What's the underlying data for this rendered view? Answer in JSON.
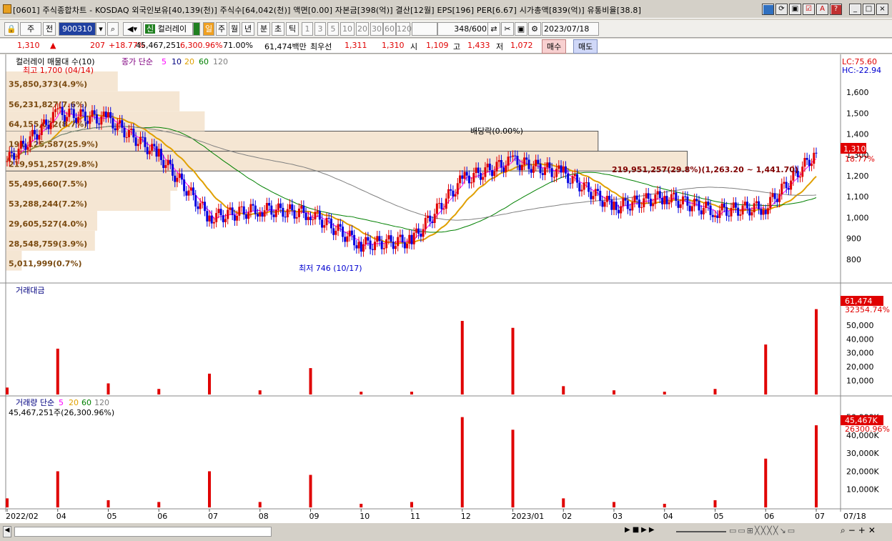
{
  "window": {
    "title": "[0601] 주식종합차트 - KOSDAQ 외국인보유[40,139(천)] 주식수[64,042(천)] 액면[0.00] 자본금[398(억)] 결산[12월] EPS[196] PER[6.67] 시가총액[839(억)] 유통비율[38.8]"
  },
  "toolbar": {
    "type": "주",
    "prev": "전",
    "code": "900310",
    "chart_style": "컬러레이",
    "period_buttons": [
      "일",
      "주",
      "월",
      "년",
      "분",
      "초",
      "틱"
    ],
    "minute_buttons": [
      "1",
      "3",
      "5",
      "10",
      "20",
      "30",
      "60",
      "120"
    ],
    "count": "348",
    "count_total": "/600",
    "date": "2023/07/18"
  },
  "quote": {
    "price": "1,310",
    "change": "207",
    "change_pct": "+18.77%",
    "volume": "45,467,251",
    "vol_ratio": "6,300.96%",
    "pct2": "71.00%",
    "amount": "61,474백만",
    "label_best": "최우선",
    "ask": "1,311",
    "bid": "1,310",
    "open_label": "시",
    "open": "1,109",
    "high_label": "고",
    "high": "1,433",
    "low_label": "저",
    "low": "1,072",
    "buy": "매수",
    "sell": "매도"
  },
  "price_panel": {
    "legend_title": "컬러레이 매물대 수(10)",
    "ma_title": "종가 단순",
    "ma_periods": [
      "5",
      "10",
      "20",
      "60",
      "120"
    ],
    "lc": "LC:75.60",
    "hc": "HC:-22.94",
    "high_marker": "최고 1,700 (04/14)",
    "low_marker": "최저 746 (10/17)",
    "dividend": "배당락(0.00%)",
    "y_ticks": [
      "1,600",
      "1,500",
      "1,400",
      "1,300",
      "1,200",
      "1,100",
      "1,000",
      "900",
      "800"
    ],
    "price_tag": "1,310",
    "price_tag_pct": "18.77%",
    "range_note": "219,951,257(29.8%)(1,263.20 ~ 1,441.70)"
  },
  "volume_profile": [
    {
      "label": "5,011,999(0.7%)",
      "from": 746,
      "to": 841,
      "pct": 0.7
    },
    {
      "label": "28,548,759(3.9%)",
      "from": 841,
      "to": 937,
      "pct": 3.9
    },
    {
      "label": "29,605,527(4.0%)",
      "from": 937,
      "to": 1032,
      "pct": 4.0
    },
    {
      "label": "53,288,244(7.2%)",
      "from": 1032,
      "to": 1128,
      "pct": 7.2
    },
    {
      "label": "55,495,660(7.5%)",
      "from": 1128,
      "to": 1223,
      "pct": 7.5
    },
    {
      "label": "219,951,257(29.8%)",
      "from": 1223,
      "to": 1318,
      "pct": 29.8
    },
    {
      "label": "191,125,587(25.9%)",
      "from": 1318,
      "to": 1414,
      "pct": 25.9
    },
    {
      "label": "64,155,022(8.7%)",
      "from": 1414,
      "to": 1509,
      "pct": 8.7
    },
    {
      "label": "56,231,827(7.6%)",
      "from": 1509,
      "to": 1605,
      "pct": 7.6
    },
    {
      "label": "35,850,373(4.9%)",
      "from": 1605,
      "to": 1700,
      "pct": 4.9
    }
  ],
  "amount_panel": {
    "title": "거래대금",
    "y_ticks": [
      "50,000",
      "40,000",
      "30,000",
      "20,000",
      "10,000"
    ],
    "tag": "61,474",
    "tag2": "32354.74%"
  },
  "volume_panel": {
    "title": "거래량 단순",
    "periods": [
      "5",
      "20",
      "60",
      "120"
    ],
    "summary": "45,467,251주(26,300.96%)",
    "y_ticks": [
      "50,000K",
      "40,000K",
      "30,000K",
      "20,000K",
      "10,000K"
    ],
    "tag": "45,467K",
    "tag2": "26300.96%"
  },
  "x_axis": {
    "labels": [
      "2022/02",
      "04",
      "05",
      "06",
      "07",
      "08",
      "09",
      "10",
      "11",
      "12",
      "2023/01",
      "02",
      "03",
      "04",
      "05",
      "06",
      "07"
    ],
    "right_label": "07/18"
  },
  "colors": {
    "up": "#e00000",
    "down": "#0000e0",
    "ma5": "#ff00ff",
    "ma10": "#000080",
    "ma20": "#e0a000",
    "ma60": "#008000",
    "ma120": "#808080",
    "profile": "#f5e6d3"
  },
  "chart_data": {
    "type": "candlestick",
    "title": "",
    "x": [
      "2022/02",
      "04",
      "05",
      "06",
      "07",
      "08",
      "09",
      "10",
      "11",
      "12",
      "2023/01",
      "02",
      "03",
      "04",
      "05",
      "06",
      "07"
    ],
    "close": [
      1270,
      1500,
      1470,
      1300,
      1000,
      1040,
      1020,
      870,
      890,
      1180,
      1270,
      1210,
      1050,
      1100,
      1030,
      1050,
      1310
    ],
    "high_price": 1700,
    "low_price": 746,
    "amount": [
      5000,
      33000,
      8000,
      4000,
      15000,
      3000,
      19000,
      2000,
      2000,
      53000,
      48000,
      6000,
      3000,
      2000,
      4000,
      36000,
      61474
    ],
    "volume_k": [
      5000,
      20000,
      4000,
      3000,
      20000,
      3000,
      18000,
      2000,
      3000,
      50000,
      43000,
      5000,
      3000,
      2000,
      4000,
      27000,
      45467
    ],
    "ylim": [
      700,
      1700
    ]
  }
}
